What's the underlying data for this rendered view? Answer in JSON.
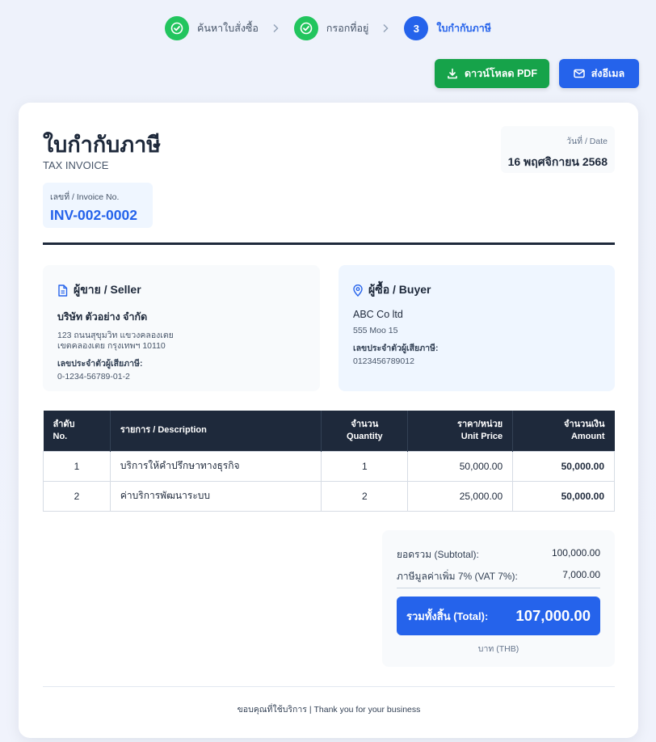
{
  "stepper": {
    "steps": [
      {
        "label": "ค้นหาใบสั่งซื้อ",
        "state": "done"
      },
      {
        "label": "กรอกที่อยู่",
        "state": "done"
      },
      {
        "number": "3",
        "label": "ใบกำกับภาษี",
        "state": "active"
      }
    ]
  },
  "actions": {
    "download_pdf": "ดาวน์โหลด PDF",
    "send_email": "ส่งอีเมล"
  },
  "invoice": {
    "title": "ใบกำกับภาษี",
    "subtitle": "TAX INVOICE",
    "date_label": "วันที่ / Date",
    "date_value": "16 พฤศจิกายน 2568",
    "number_label": "เลขที่ / Invoice No.",
    "number_value": "INV-002-0002"
  },
  "seller": {
    "heading": "ผู้ขาย / Seller",
    "name": "บริษัท ตัวอย่าง จำกัด",
    "address_line1": "123 ถนนสุขุมวิท แขวงคลองเตย",
    "address_line2": "เขตคลองเตย กรุงเทพฯ 10110",
    "tax_label": "เลขประจำตัวผู้เสียภาษี:",
    "tax_id": "0-1234-56789-01-2"
  },
  "buyer": {
    "heading": "ผู้ซื้อ / Buyer",
    "name": "ABC Co ltd",
    "address_line1": "555 Moo 15",
    "tax_label": "เลขประจำตัวผู้เสียภาษี:",
    "tax_id": "0123456789012"
  },
  "table": {
    "headers": {
      "no_th": "ลำดับ",
      "no_en": "No.",
      "desc": "รายการ / Description",
      "qty_th": "จำนวน",
      "qty_en": "Quantity",
      "price_th": "ราคา/หน่วย",
      "price_en": "Unit Price",
      "amount_th": "จำนวนเงิน",
      "amount_en": "Amount"
    },
    "rows": [
      {
        "no": "1",
        "desc": "บริการให้คำปรึกษาทางธุรกิจ",
        "qty": "1",
        "price": "50,000.00",
        "amount": "50,000.00"
      },
      {
        "no": "2",
        "desc": "ค่าบริการพัฒนาระบบ",
        "qty": "2",
        "price": "25,000.00",
        "amount": "50,000.00"
      }
    ]
  },
  "totals": {
    "subtotal_label": "ยอดรวม (Subtotal):",
    "subtotal_value": "100,000.00",
    "vat_label": "ภาษีมูลค่าเพิ่ม 7% (VAT 7%):",
    "vat_value": "7,000.00",
    "total_label": "รวมทั้งสิ้น (Total):",
    "total_value": "107,000.00",
    "currency": "บาท (THB)"
  },
  "footer": {
    "text": "ขอบคุณที่ใช้บริการ | Thank you for your business"
  },
  "colors": {
    "primary": "#2563eb",
    "success": "#16a34a",
    "dark": "#1e293b"
  }
}
